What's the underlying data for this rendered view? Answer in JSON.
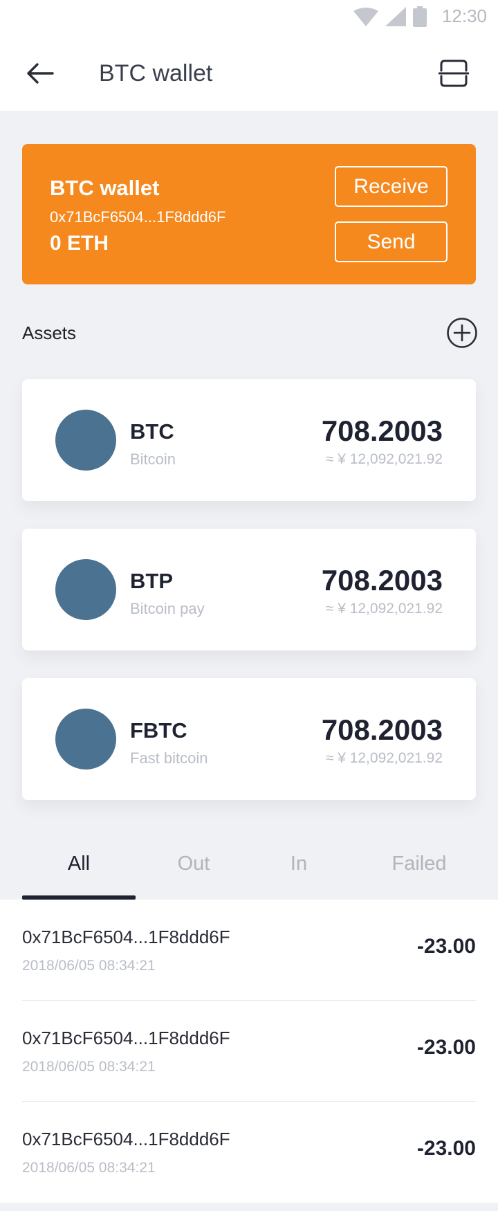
{
  "status_bar": {
    "time": "12:30",
    "icons": [
      "wifi-icon",
      "signal-icon",
      "battery-icon"
    ]
  },
  "app_bar": {
    "title": "BTC wallet",
    "back_icon": "arrow-left-icon",
    "action_icon": "scan-icon"
  },
  "wallet": {
    "name": "BTC wallet",
    "address": "0x71BcF6504...1F8ddd6F",
    "balance": "0 ETH",
    "receive_label": "Receive",
    "send_label": "Send",
    "accent_color": "#f5891d"
  },
  "assets": {
    "title": "Assets",
    "add_icon": "plus-circle-icon",
    "items": [
      {
        "symbol": "BTC",
        "name": "Bitcoin",
        "amount": "708.2003",
        "fiat": "≈ ¥ 12,092,021.92"
      },
      {
        "symbol": "BTP",
        "name": "Bitcoin pay",
        "amount": "708.2003",
        "fiat": "≈ ¥ 12,092,021.92"
      },
      {
        "symbol": "FBTC",
        "name": "Fast bitcoin",
        "amount": "708.2003",
        "fiat": "≈ ¥ 12,092,021.92"
      }
    ]
  },
  "tabs": [
    {
      "label": "All",
      "active": true
    },
    {
      "label": "Out",
      "active": false
    },
    {
      "label": "In",
      "active": false
    },
    {
      "label": "Failed",
      "active": false
    }
  ],
  "transactions": [
    {
      "address": "0x71BcF6504...1F8ddd6F",
      "date": "2018/06/05 08:34:21",
      "amount": "-23.00"
    },
    {
      "address": "0x71BcF6504...1F8ddd6F",
      "date": "2018/06/05 08:34:21",
      "amount": "-23.00"
    },
    {
      "address": "0x71BcF6504...1F8ddd6F",
      "date": "2018/06/05 08:34:21",
      "amount": "-23.00"
    }
  ]
}
